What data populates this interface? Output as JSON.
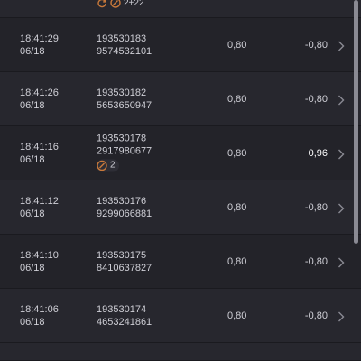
{
  "top_row": {
    "badge_text": "2+22"
  },
  "bets": [
    {
      "time": "18:41:29",
      "date": "06/18",
      "id": "193530183",
      "ticket": "9574532101",
      "stake": "0,80",
      "profit": "-0,80",
      "badge": null,
      "win": false
    },
    {
      "time": "18:41:26",
      "date": "06/18",
      "id": "193530182",
      "ticket": "5653650947",
      "stake": "0,80",
      "profit": "-0,80",
      "badge": null,
      "win": false
    },
    {
      "time": "18:41:16",
      "date": "06/18",
      "id": "193530178",
      "ticket": "2917980677",
      "stake": "0,80",
      "profit": "0,96",
      "badge": "2",
      "win": true
    },
    {
      "time": "18:41:12",
      "date": "06/18",
      "id": "193530176",
      "ticket": "9299066881",
      "stake": "0,80",
      "profit": "-0,80",
      "badge": null,
      "win": false
    },
    {
      "time": "18:41:10",
      "date": "06/18",
      "id": "193530175",
      "ticket": "8410637827",
      "stake": "0,80",
      "profit": "-0,80",
      "badge": null,
      "win": false
    },
    {
      "time": "18:41:06",
      "date": "06/18",
      "id": "193530174",
      "ticket": "4653241861",
      "stake": "0,80",
      "profit": "-0,80",
      "badge": null,
      "win": false
    }
  ],
  "icons": {
    "badge": "multiplier-icon",
    "refresh": "refresh-icon",
    "row_action": "chevron-right-icon"
  },
  "colors": {
    "background": "#232329",
    "row_background": "#27272e",
    "badge_accent": "#c9793a",
    "win_text": "#ffffff"
  }
}
